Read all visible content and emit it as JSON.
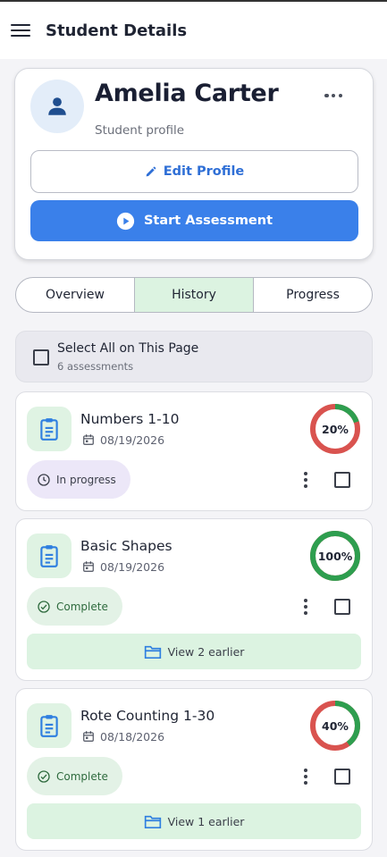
{
  "header": {
    "title": "Student Details"
  },
  "profile": {
    "name": "Amelia Carter",
    "subtitle": "Student profile",
    "edit_label": "Edit Profile",
    "start_label": "Start Assessment"
  },
  "tabs": [
    {
      "label": "Overview",
      "active": false
    },
    {
      "label": "History",
      "active": true
    },
    {
      "label": "Progress",
      "active": false
    }
  ],
  "select_all": {
    "label": "Select All on This Page",
    "count": "6 assessments"
  },
  "assessments": [
    {
      "title": "Numbers 1-10",
      "date": "08/19/2026",
      "percent_label": "20%",
      "percent": 20,
      "status": "In progress",
      "status_kind": "progress",
      "earlier": ""
    },
    {
      "title": "Basic Shapes",
      "date": "08/19/2026",
      "percent_label": "100%",
      "percent": 100,
      "status": "Complete",
      "status_kind": "complete",
      "earlier": "View 2 earlier"
    },
    {
      "title": "Rote Counting 1-30",
      "date": "08/18/2026",
      "percent_label": "40%",
      "percent": 40,
      "status": "Complete",
      "status_kind": "complete",
      "earlier": "View 1 earlier"
    }
  ],
  "icons": {
    "menu": "menu-icon",
    "avatar": "person-icon",
    "more": "more-horizontal-icon",
    "edit": "pencil-icon",
    "start": "play-circle-icon",
    "assessment": "clipboard-icon",
    "date": "calendar-icon",
    "in_progress": "clock-icon",
    "complete": "check-circle-icon",
    "earlier": "folder-icon"
  },
  "colors": {
    "primary": "#3a80ea",
    "accent_green": "#2e9e4f",
    "ring_red": "#d9534f",
    "chip_progress_bg": "#ece7f8",
    "chip_complete_bg": "#e3f2e6",
    "tab_active_bg": "#dcf3e1"
  }
}
